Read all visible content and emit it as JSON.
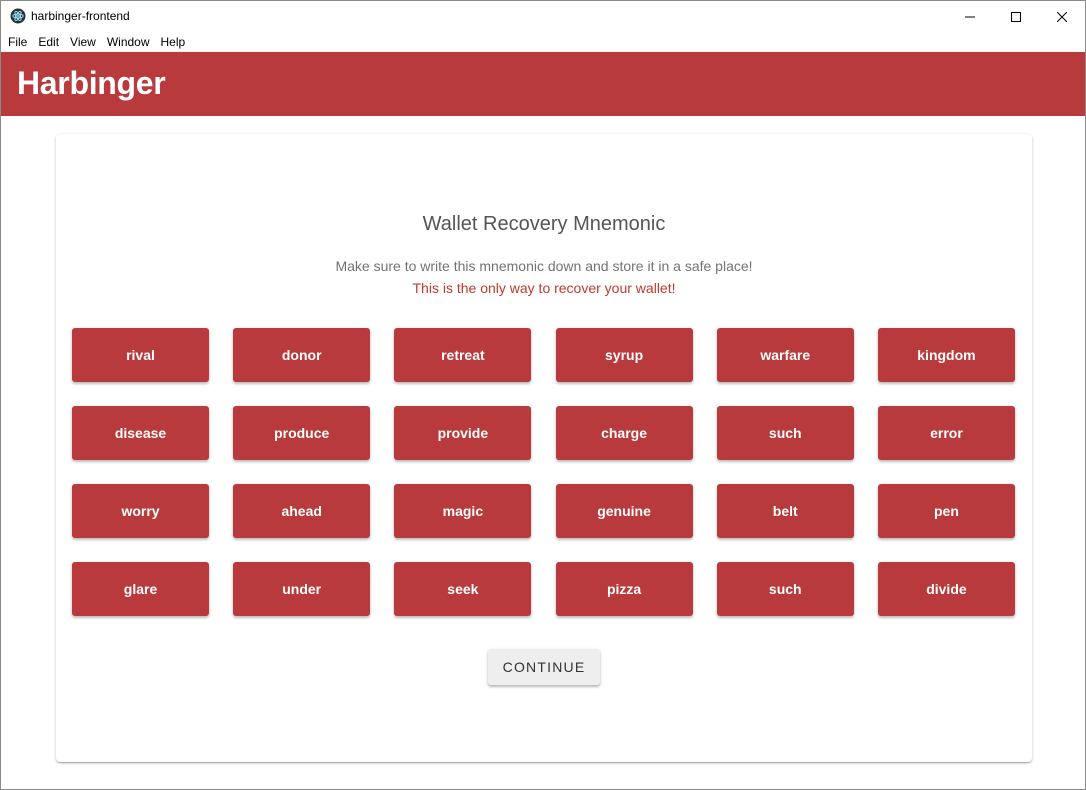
{
  "window": {
    "title": "harbinger-frontend",
    "icon": "electron-icon"
  },
  "menu": [
    "File",
    "Edit",
    "View",
    "Window",
    "Help"
  ],
  "appbar": {
    "brand": "Harbinger",
    "color": "#b83a3c"
  },
  "card": {
    "title": "Wallet Recovery Mnemonic",
    "subtitle": "Make sure to write this mnemonic down and store it in a safe place!",
    "warning": "This is the only way to recover your wallet!",
    "warning_color": "#c0392b",
    "words": [
      "rival",
      "donor",
      "retreat",
      "syrup",
      "warfare",
      "kingdom",
      "disease",
      "produce",
      "provide",
      "charge",
      "such",
      "error",
      "worry",
      "ahead",
      "magic",
      "genuine",
      "belt",
      "pen",
      "glare",
      "under",
      "seek",
      "pizza",
      "such",
      "divide"
    ],
    "continue_label": "CONTINUE"
  }
}
